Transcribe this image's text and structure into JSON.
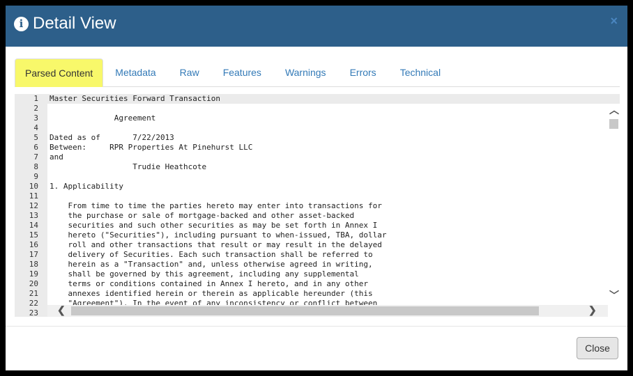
{
  "modal": {
    "title": "Detail View",
    "close_x": "×",
    "close_button": "Close"
  },
  "tabs": [
    "Parsed Content",
    "Metadata",
    "Raw",
    "Features",
    "Warnings",
    "Errors",
    "Technical"
  ],
  "lines": [
    "Master Securities Forward Transaction",
    "",
    "              Agreement",
    "",
    "Dated as of       7/22/2013",
    "Between:     RPR Properties At Pinehurst LLC",
    "and",
    "                  Trudie Heathcote",
    "",
    "1. Applicability",
    "",
    "    From time to time the parties hereto may enter into transactions for",
    "    the purchase or sale of mortgage-backed and other asset-backed",
    "    securities and such other securities as may be set forth in Annex I",
    "    hereto (\"Securities\"), including pursuant to when-issued, TBA, dollar",
    "    roll and other transactions that result or may result in the delayed",
    "    delivery of Securities. Each such transaction shall be referred to",
    "    herein as a \"Transaction\" and, unless otherwise agreed in writing,",
    "    shall be governed by this agreement, including any supplemental",
    "    terms or conditions contained in Annex I hereto, and in any other",
    "    annexes identified herein or therein as applicable hereunder (this",
    "    \"Agreement\"). In the event of any inconsistency or conflict between",
    ""
  ]
}
